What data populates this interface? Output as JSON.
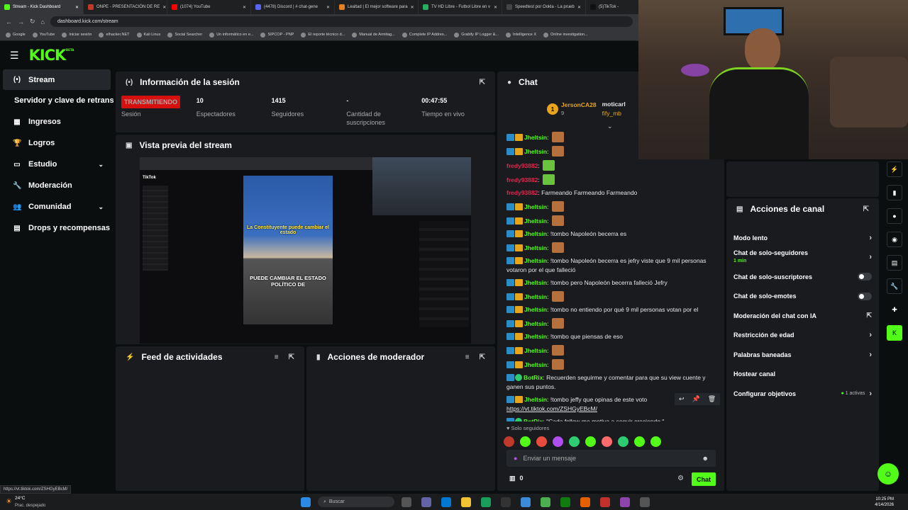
{
  "browser": {
    "tabs": [
      {
        "label": "Stream - Kick Dashboard",
        "color": "#53fc18"
      },
      {
        "label": "ONPE - PRESENTACIÓN DE RE",
        "color": "#c0392b"
      },
      {
        "label": "(1074) YouTube",
        "color": "#ff0000"
      },
      {
        "label": "(4478) Discord | # chat-gene",
        "color": "#5865f2"
      },
      {
        "label": "Lealtad | El mejor software para",
        "color": "#e67e22"
      },
      {
        "label": "TV HD Libre - Futbol Libre en v",
        "color": "#27ae60"
      },
      {
        "label": "Speedtest por Ookla - La prueb",
        "color": "#444444"
      },
      {
        "label": "(5)TikTok -",
        "color": "#111111"
      }
    ],
    "url": "dashboard.kick.com/stream",
    "bookmarks": [
      "Google",
      "YouTube",
      "Iniciar sesión",
      "elhacker.NET",
      "Kali Linux",
      "Social Searcher",
      "Un informático en e...",
      "SIPCOP - PNP",
      "El reporte técnico d...",
      "Manual de Armitag...",
      "Complete IP Addres...",
      "Grabify IP Logger &...",
      "Intelligence X",
      "Online investigation..."
    ]
  },
  "kick": {
    "logo": "KICK",
    "logo_sup": "BETA"
  },
  "sidebar": {
    "items": [
      {
        "label": "Stream",
        "icon": "(•)"
      },
      {
        "label": "Servidor y clave de retransmisión"
      },
      {
        "label": "Ingresos",
        "icon": "▦"
      },
      {
        "label": "Logros",
        "icon": "🏆"
      },
      {
        "label": "Estudio",
        "icon": "▭"
      },
      {
        "label": "Moderación",
        "icon": "🔧"
      },
      {
        "label": "Comunidad",
        "icon": "👥"
      },
      {
        "label": "Drops y recompensas",
        "icon": "▤"
      }
    ]
  },
  "session": {
    "title": "Información de la sesión",
    "status": "TRANSMITIENDO",
    "status_label": "Sesión",
    "viewers": "10",
    "viewers_label": "Espectadores",
    "followers": "1415",
    "followers_label": "Seguidores",
    "subs": "-",
    "subs_label": "Cantidad de suscripciones",
    "live_time": "00:47:55",
    "live_time_label": "Tiempo en vivo"
  },
  "preview": {
    "title": "Vista previa del stream",
    "caption_top": "La Constituyente puede cambiar el estado",
    "caption_bottom": "PUEDE CAMBIAR EL ESTADO POLÍTICO DE",
    "tiktok_label": "TikTok"
  },
  "feed": {
    "title": "Feed de actividades"
  },
  "modactions": {
    "title": "Acciones de moderador"
  },
  "chat": {
    "title": "Chat",
    "pinned": {
      "user1": "JersonCA28",
      "user1_count": "9",
      "user2": "moticarl",
      "user3": "fify_mb"
    },
    "messages": [
      {
        "user": "Jheltsin",
        "color": "#53fc18",
        "text": "",
        "emote": true
      },
      {
        "user": "Jheltsin",
        "color": "#53fc18",
        "text": "",
        "emote": true
      },
      {
        "user": "fredy93882",
        "color": "#e8234e",
        "text": "",
        "emote2": true
      },
      {
        "user": "fredy93882",
        "color": "#e8234e",
        "text": "",
        "emote2": true
      },
      {
        "user": "fredy93882",
        "color": "#e8234e",
        "text": "Farmeando Farmeando Farmeando"
      },
      {
        "user": "Jheltsin",
        "color": "#53fc18",
        "text": "",
        "emote": true
      },
      {
        "user": "Jheltsin",
        "color": "#53fc18",
        "text": "",
        "emote": true
      },
      {
        "user": "Jheltsin",
        "color": "#53fc18",
        "text": "!tombo Napoleón becerra es"
      },
      {
        "user": "Jheltsin",
        "color": "#53fc18",
        "text": "",
        "emote": true
      },
      {
        "user": "Jheltsin",
        "color": "#53fc18",
        "text": "!tombo Napoleón becerra es jefry viste que 9 mil personas votaron por el que falleció"
      },
      {
        "user": "Jheltsin",
        "color": "#53fc18",
        "text": "!tombo pero Napoleón becerra falleció Jefry"
      },
      {
        "user": "Jheltsin",
        "color": "#53fc18",
        "text": "",
        "emote": true
      },
      {
        "user": "Jheltsin",
        "color": "#53fc18",
        "text": "!tombo no entiendo por qué 9 mil personas votan por el"
      },
      {
        "user": "Jheltsin",
        "color": "#53fc18",
        "text": "",
        "emote": true
      },
      {
        "user": "Jheltsin",
        "color": "#53fc18",
        "text": "!tombo que piensas de eso"
      },
      {
        "user": "Jheltsin",
        "color": "#53fc18",
        "text": "",
        "emote": true
      },
      {
        "user": "Jheltsin",
        "color": "#53fc18",
        "text": "",
        "emote": true
      },
      {
        "user": "BotRix",
        "color": "#53fc18",
        "text": "Recuerden seguirme y comentar para que su view cuente y ganen sus puntos."
      },
      {
        "user": "Jheltsin",
        "color": "#53fc18",
        "text": "!tombo jeffy que opinas de este voto",
        "link": "https://vt.tiktok.com/ZSHGyEBcM/"
      },
      {
        "user": "BotRix",
        "color": "#53fc18",
        "text": "\"Cada follow me motiva a seguir creciendo.\""
      }
    ],
    "followers_only": "Solo seguidores",
    "placeholder": "Enviar un mensaje",
    "points": "0",
    "send_label": "Chat"
  },
  "channel_actions": {
    "title": "Acciones de canal",
    "rows": [
      {
        "label": "Modo lento",
        "kind": "arrow"
      },
      {
        "label": "Chat de solo-seguidores",
        "sub": "1 min",
        "kind": "arrow"
      },
      {
        "label": "Chat de solo-suscriptores",
        "kind": "toggle"
      },
      {
        "label": "Chat de solo-emotes",
        "kind": "toggle"
      },
      {
        "label": "Moderación del chat con IA",
        "kind": "ext"
      },
      {
        "label": "Restricción de edad",
        "kind": "arrow"
      },
      {
        "label": "Palabras baneadas",
        "kind": "arrow"
      },
      {
        "label": "Hostear canal",
        "kind": "none"
      },
      {
        "label": "Configurar objetivos",
        "extra": "1 activas",
        "kind": "arrow"
      }
    ]
  },
  "status_url": "https://vt.tiktok.com/ZSHGyEBcM/",
  "taskbar": {
    "weather_temp": "24°C",
    "weather_desc": "Prac. despejado",
    "search": "Buscar",
    "time": "10:25 PM",
    "date": "4/14/2026"
  }
}
